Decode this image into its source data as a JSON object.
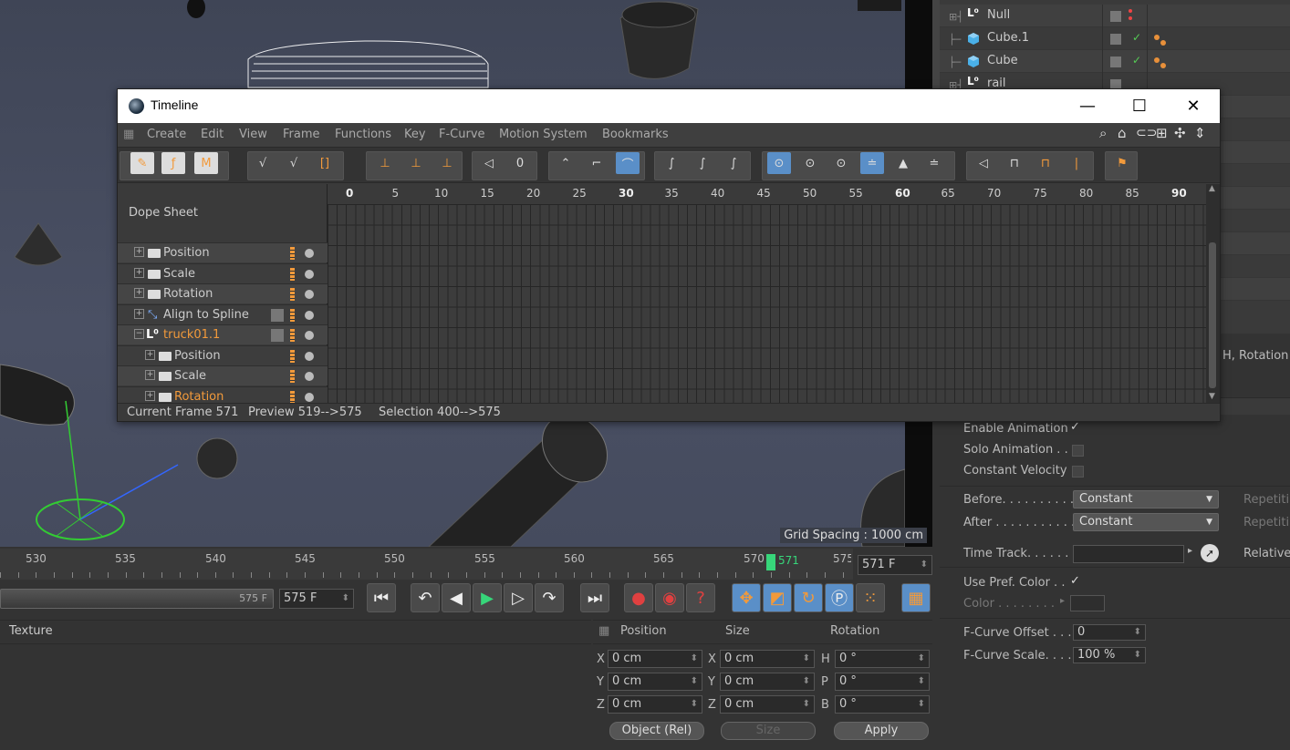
{
  "timeline_window": {
    "title": "Timeline",
    "window_controls": {
      "minimize": "—",
      "maximize": "☐",
      "close": "✕"
    },
    "menu": [
      "Create",
      "Edit",
      "View",
      "Frame",
      "Functions",
      "Key",
      "F-Curve",
      "Motion System",
      "Bookmarks"
    ],
    "panel_title": "Dope Sheet",
    "frame_ruler": [
      "0",
      "5",
      "10",
      "15",
      "20",
      "25",
      "30",
      "35",
      "40",
      "45",
      "50",
      "55",
      "60",
      "65",
      "70",
      "75",
      "80",
      "85",
      "90"
    ],
    "bold_frames": [
      "0",
      "30",
      "60",
      "90"
    ],
    "tracks": [
      {
        "label": "Position",
        "indent": 0,
        "type": "folder",
        "color": "normal"
      },
      {
        "label": "Scale",
        "indent": 0,
        "type": "folder",
        "color": "normal"
      },
      {
        "label": "Rotation",
        "indent": 0,
        "type": "folder",
        "color": "normal"
      },
      {
        "label": "Align to Spline",
        "indent": 0,
        "type": "tag",
        "color": "normal"
      },
      {
        "label": "truck01.1",
        "indent": 0,
        "type": "null",
        "color": "orange"
      },
      {
        "label": "Position",
        "indent": 1,
        "type": "folder",
        "color": "normal"
      },
      {
        "label": "Scale",
        "indent": 1,
        "type": "folder",
        "color": "normal"
      },
      {
        "label": "Rotation",
        "indent": 1,
        "type": "folder",
        "color": "orange"
      }
    ],
    "status": {
      "current_frame": "Current Frame  571",
      "preview": "Preview  519-->575",
      "selection": "Selection 400-->575"
    }
  },
  "object_manager": {
    "rows": [
      {
        "name": "Null",
        "icon": "null-icon"
      },
      {
        "name": "Cube.1",
        "icon": "cube-icon"
      },
      {
        "name": "Cube",
        "icon": "cube-icon"
      },
      {
        "name": "rail",
        "icon": "null-icon"
      }
    ]
  },
  "attributes": {
    "header_fragment": "H, Rotation",
    "enable_animation": "Enable Animation",
    "solo_animation": "Solo Animation . .",
    "constant_velocity": "Constant Velocity",
    "before_label": "Before. . . . . . . . . .",
    "before_value": "Constant",
    "after_label": "After . . . . . . . . . . .",
    "after_value": "Constant",
    "repetitions": "Repetiti",
    "time_track": "Time Track. . . . . .",
    "relative": "Relative",
    "use_pref_color": "Use Pref. Color . .",
    "color": "Color . . . . . . . .",
    "fcurve_offset_label": "F-Curve Offset . . .",
    "fcurve_offset_value": "0",
    "fcurve_scale_label": "F-Curve Scale. . . .",
    "fcurve_scale_value": "100 %"
  },
  "viewport": {
    "grid_spacing": "Grid Spacing : 1000 cm"
  },
  "timebar": {
    "ruler": [
      "530",
      "535",
      "540",
      "545",
      "550",
      "555",
      "560",
      "565",
      "570",
      "575"
    ],
    "current_frame": "571",
    "current_frame_field": "571 F",
    "end_field": "575 F",
    "range_end": "575 F"
  },
  "material_panel": {
    "tab": "Texture"
  },
  "coordinates": {
    "headers": [
      "Position",
      "Size",
      "Rotation"
    ],
    "rows": [
      {
        "pos_axis": "X",
        "pos": "0 cm",
        "size_axis": "X",
        "size": "0 cm",
        "rot_axis": "H",
        "rot": "0 °"
      },
      {
        "pos_axis": "Y",
        "pos": "0 cm",
        "size_axis": "Y",
        "size": "0 cm",
        "rot_axis": "P",
        "rot": "0 °"
      },
      {
        "pos_axis": "Z",
        "pos": "0 cm",
        "size_axis": "Z",
        "size": "0 cm",
        "rot_axis": "B",
        "rot": "0 °"
      }
    ],
    "mode": "Object (Rel)",
    "size_mode": "Size",
    "apply": "Apply"
  },
  "colors": {
    "accent": "#f29a3b",
    "active_blue": "#5a8fc8",
    "playhead": "#37d67a"
  }
}
